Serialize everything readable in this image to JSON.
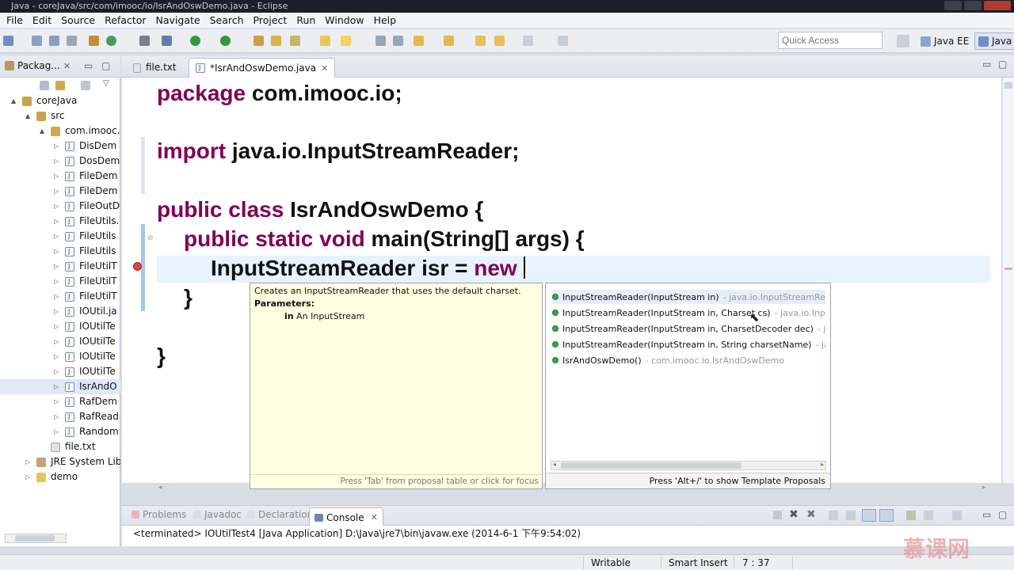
{
  "window": {
    "title": "Java - coreJava/src/com/imooc/io/IsrAndOswDemo.java - Eclipse"
  },
  "menu": [
    "File",
    "Edit",
    "Source",
    "Refactor",
    "Navigate",
    "Search",
    "Project",
    "Run",
    "Window",
    "Help"
  ],
  "toolbar": {
    "quick_access_placeholder": "Quick Access",
    "perspectives": [
      "Java EE",
      "Java"
    ]
  },
  "explorer": {
    "tab_label": "Packag...",
    "items": [
      {
        "label": "coreJava",
        "depth": 0,
        "arrow": "▲",
        "icon": "project-icon"
      },
      {
        "label": "src",
        "depth": 1,
        "arrow": "▲",
        "icon": "source-folder-icon"
      },
      {
        "label": "com.imooc.",
        "depth": 2,
        "arrow": "▲",
        "icon": "package-icon"
      },
      {
        "label": "DisDem",
        "depth": 3,
        "arrow": "▷",
        "icon": "java-file-icon"
      },
      {
        "label": "DosDem",
        "depth": 3,
        "arrow": "▷",
        "icon": "java-file-icon"
      },
      {
        "label": "FileDem",
        "depth": 3,
        "arrow": "▷",
        "icon": "java-file-icon"
      },
      {
        "label": "FileDem",
        "depth": 3,
        "arrow": "▷",
        "icon": "java-file-icon"
      },
      {
        "label": "FileOutD",
        "depth": 3,
        "arrow": "▷",
        "icon": "java-file-icon"
      },
      {
        "label": "FileUtils.",
        "depth": 3,
        "arrow": "▷",
        "icon": "java-file-icon"
      },
      {
        "label": "FileUtils",
        "depth": 3,
        "arrow": "▷",
        "icon": "java-file-icon"
      },
      {
        "label": "FileUtils",
        "depth": 3,
        "arrow": "▷",
        "icon": "java-file-icon"
      },
      {
        "label": "FileUtilT",
        "depth": 3,
        "arrow": "▷",
        "icon": "java-file-icon"
      },
      {
        "label": "FileUtilT",
        "depth": 3,
        "arrow": "▷",
        "icon": "java-file-icon"
      },
      {
        "label": "FileUtilT",
        "depth": 3,
        "arrow": "▷",
        "icon": "java-file-icon"
      },
      {
        "label": "IOUtil.ja",
        "depth": 3,
        "arrow": "▷",
        "icon": "java-file-icon"
      },
      {
        "label": "IOUtilTe",
        "depth": 3,
        "arrow": "▷",
        "icon": "java-file-icon"
      },
      {
        "label": "IOUtilTe",
        "depth": 3,
        "arrow": "▷",
        "icon": "java-file-icon"
      },
      {
        "label": "IOUtilTe",
        "depth": 3,
        "arrow": "▷",
        "icon": "java-file-icon"
      },
      {
        "label": "IOUtilTe",
        "depth": 3,
        "arrow": "▷",
        "icon": "java-file-icon"
      },
      {
        "label": "IsrAndO",
        "depth": 3,
        "arrow": "▷",
        "icon": "java-file-icon",
        "selected": true
      },
      {
        "label": "RafDem",
        "depth": 3,
        "arrow": "▷",
        "icon": "java-file-icon"
      },
      {
        "label": "RafRead",
        "depth": 3,
        "arrow": "▷",
        "icon": "java-file-icon"
      },
      {
        "label": "Random",
        "depth": 3,
        "arrow": "▷",
        "icon": "java-file-icon"
      },
      {
        "label": "file.txt",
        "depth": 2,
        "arrow": "",
        "icon": "text-file-icon"
      },
      {
        "label": "JRE System Lib",
        "depth": 1,
        "arrow": "▷",
        "icon": "library-icon"
      },
      {
        "label": "demo",
        "depth": 1,
        "arrow": "▷",
        "icon": "folder-icon"
      }
    ]
  },
  "editor": {
    "tabs": [
      {
        "label": "file.txt",
        "active": false
      },
      {
        "label": "*IsrAndOswDemo.java",
        "active": true
      }
    ],
    "lines": {
      "l1_kw": "package",
      "l1_rest": " com.imooc.io;",
      "l2_kw": "import",
      "l2_rest": " java.io.InputStreamReader;",
      "l3_kw": "public class",
      "l3_rest": " IsrAndOswDemo {",
      "l4_kw": "public static void",
      "l4_rest": " main(String[] args) {",
      "l5_a": "InputStreamReader isr = ",
      "l5_kw": "new",
      "l6": "}",
      "l7": "}"
    }
  },
  "javadoc": {
    "desc": "Creates an InputStreamReader that uses the default charset.",
    "params_label": "Parameters:",
    "param_name": "in",
    "param_desc": " An InputStream",
    "footer": "Press 'Tab' from proposal table or click for focus"
  },
  "proposals": {
    "items": [
      {
        "main": "InputStreamReader(InputStream in)",
        "sub": " - java.io.InputStreamRea"
      },
      {
        "main": "InputStreamReader(InputStream in, Charset cs)",
        "sub": " - java.io.Inpu"
      },
      {
        "main": "InputStreamReader(InputStream in, CharsetDecoder dec)",
        "sub": " - ja"
      },
      {
        "main": "InputStreamReader(InputStream in, String charsetName)",
        "sub": " - ja"
      },
      {
        "main": "IsrAndOswDemo()",
        "sub": " - com.imooc.io.IsrAndOswDemo"
      }
    ],
    "footer": "Press 'Alt+/' to show Template Proposals"
  },
  "bottom_panel": {
    "tabs": [
      "Problems",
      "Javadoc",
      "Declaration",
      "Console"
    ],
    "console_text": "<terminated> IOUtilTest4 [Java Application] D:\\Java\\jre7\\bin\\javaw.exe (2014-6-1 下午9:54:02)"
  },
  "status": {
    "writable": "Writable",
    "insert_mode": "Smart Insert",
    "position": "7 : 37"
  },
  "watermark": "慕课网",
  "colors": {
    "keyword": "#7f0055",
    "current_line": "#e8f2fe",
    "javadoc_bg": "#ffffe1",
    "proposal_dot": "#3aa64a"
  }
}
